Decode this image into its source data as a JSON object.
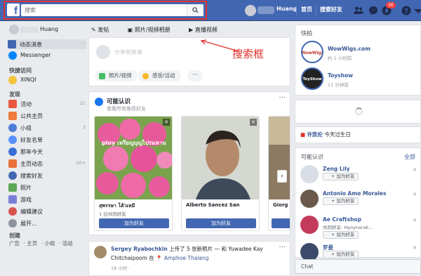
{
  "topbar": {
    "search_placeholder": "搜索",
    "user_name": "Huang",
    "home": "首页",
    "find_friends": "搜索好友",
    "notif_count": "36"
  },
  "annotation": "搜索框",
  "left": {
    "user_name": "Huang",
    "main_items": [
      {
        "label": "动态消息",
        "extra": "···"
      },
      {
        "label": "Messenger"
      }
    ],
    "shortcuts_heading": "快捷访问",
    "shortcut": "XINQI",
    "explore_heading": "发现",
    "explore_items": [
      {
        "label": "活动",
        "count": "21"
      },
      {
        "label": "公共主页"
      },
      {
        "label": "小组",
        "count": "3"
      },
      {
        "label": "好友名单"
      },
      {
        "label": "那年今天"
      },
      {
        "label": "主页动态",
        "count": "20+"
      },
      {
        "label": "搜索好友"
      },
      {
        "label": "照片"
      },
      {
        "label": "游戏"
      },
      {
        "label": "编辑建议"
      },
      {
        "label": "展开..."
      }
    ],
    "create_heading": "创建",
    "create_links": [
      "广告",
      "· 主页",
      "· 小组",
      "· 活动"
    ]
  },
  "composer": {
    "tabs": [
      "发帖",
      "照片/视频相册",
      "直播视频"
    ],
    "placeholder": "分享新鲜事",
    "actions": [
      "照片/视频",
      "感受/活动"
    ],
    "more": "···"
  },
  "pymk": {
    "title": "可能认识",
    "subtitle": "查看所有推荐好友",
    "menu": "···",
    "cards": [
      {
        "name": "สุพรรษา โต้วเหมี",
        "mutual": "1 位共同好友",
        "button": "加为好友"
      },
      {
        "name": "Alberto Sancez San",
        "mutual": "",
        "button": "加为好友"
      },
      {
        "name": "Giorg",
        "mutual": "",
        "button": ""
      }
    ],
    "photo_caption": "ploy เหรียญบุญไปรมหาน",
    "next": "›"
  },
  "post": {
    "author": "Sergey Ryabochkin",
    "action": "上传了 5 张新照片 — 和 Yuwadee Kay",
    "location_prefix": "Chitchaipoom 在",
    "location": "Amphoe Thalang",
    "time": "18 小时 ·",
    "menu": "···"
  },
  "right": {
    "stories_heading": "快拍",
    "stories": [
      {
        "name": "WowWigs.com",
        "time": "约 1 小时前"
      },
      {
        "name": "Toyshow",
        "time": "11 分钟前"
      }
    ],
    "birthday_name": "许凯伦",
    "birthday_text": "今天过生日",
    "pymk_heading": "可能认识",
    "see_all": "全部",
    "people": [
      {
        "name": "Zeng Lily",
        "sub": "",
        "button": "加为好友"
      },
      {
        "name": "Antonio Amo Morales",
        "sub": "",
        "button": "加为好友"
      },
      {
        "name": "Ae Craftshop",
        "sub": "共同好友: Hyoynarak...",
        "button": "加为好友"
      },
      {
        "name": "罗曼",
        "sub": "",
        "button": "加为好友"
      }
    ],
    "chat_label": "Chat"
  },
  "colors": {
    "brand": "#4267b2",
    "annotation": "#e0312d",
    "link": "#385898"
  }
}
